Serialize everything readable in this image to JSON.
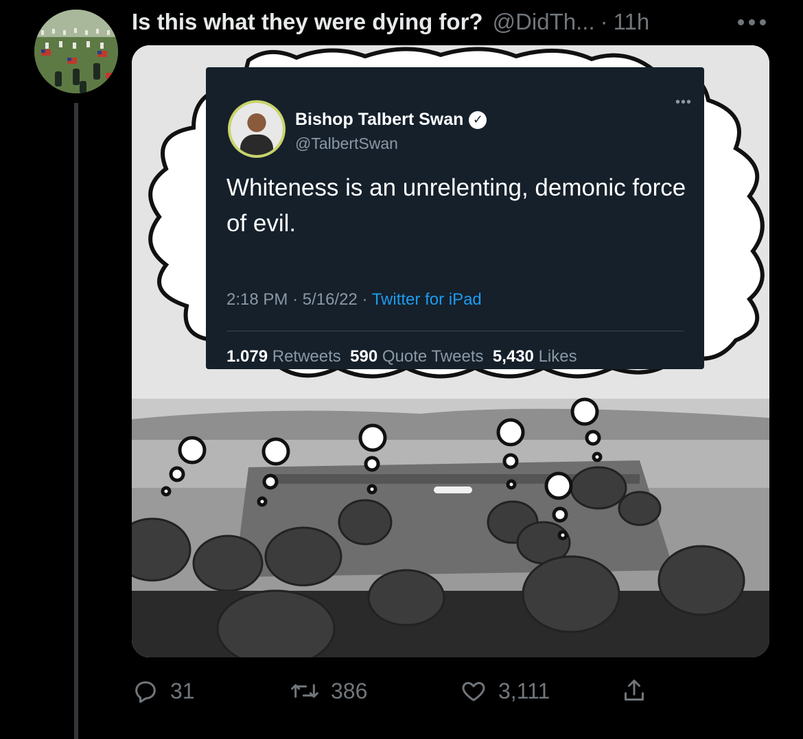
{
  "post": {
    "display_name": "Is this what they were dying for?",
    "handle": "@DidTh...",
    "separator": "·",
    "time": "11h"
  },
  "embed": {
    "name": "Bishop Talbert Swan",
    "handle": "@TalbertSwan",
    "text": "Whiteness is an unrelenting, demonic force of evil.",
    "time": "2:18 PM",
    "date": "5/16/22",
    "source": "Twitter for iPad",
    "meta_sep": "·",
    "retweets_count": "1.079",
    "retweets_label": "Retweets",
    "quotes_count": "590",
    "quotes_label": "Quote Tweets",
    "likes_count": "5,430",
    "likes_label": "Likes"
  },
  "actions": {
    "reply_count": "31",
    "retweet_count": "386",
    "like_count": "3,111"
  },
  "icons": {
    "reply": "reply-icon",
    "retweet": "retweet-icon",
    "like": "heart-icon",
    "share": "share-icon",
    "more": "more-icon",
    "verified": "verified-icon"
  },
  "colors": {
    "background": "#000000",
    "text": "#e7e9ea",
    "muted": "#71767b",
    "embed_bg": "#15202b",
    "link": "#1d9bf0"
  }
}
